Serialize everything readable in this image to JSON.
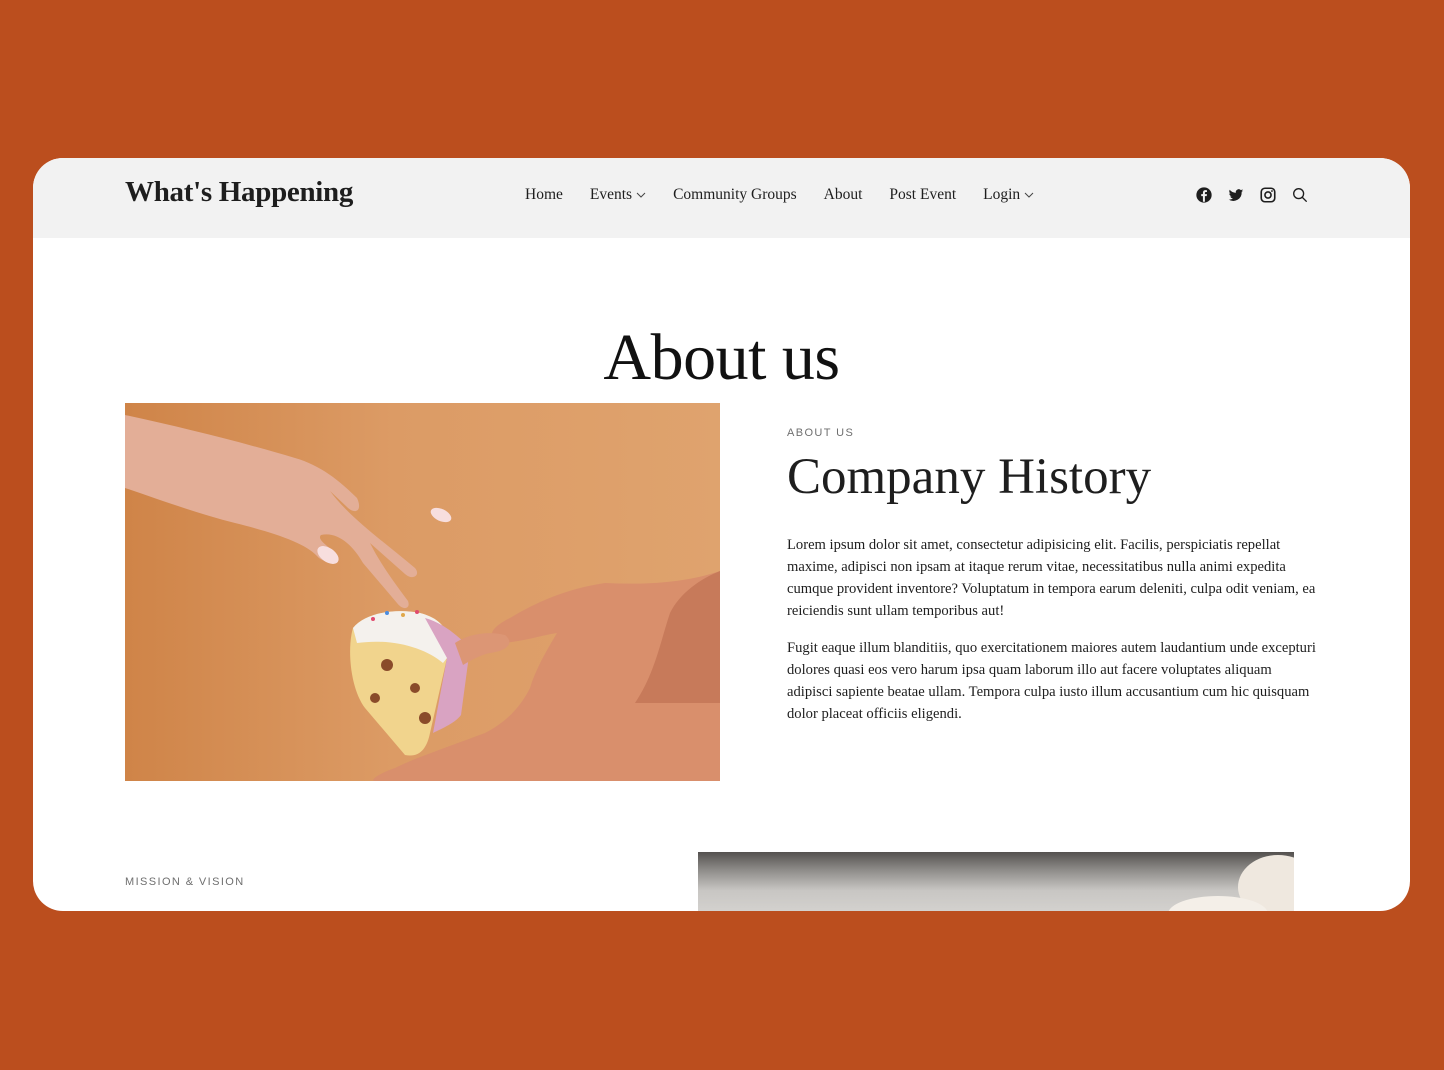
{
  "site": {
    "title": "What's Happening"
  },
  "nav": {
    "items": [
      {
        "label": "Home",
        "dropdown": false
      },
      {
        "label": "Events",
        "dropdown": true
      },
      {
        "label": "Community Groups",
        "dropdown": false
      },
      {
        "label": "About",
        "dropdown": false
      },
      {
        "label": "Post Event",
        "dropdown": false
      },
      {
        "label": "Login",
        "dropdown": true
      }
    ]
  },
  "social": {
    "icons": [
      "facebook-icon",
      "twitter-icon",
      "instagram-icon",
      "search-icon"
    ]
  },
  "page": {
    "title": "About us"
  },
  "history": {
    "eyebrow": "ABOUT US",
    "title": "Company History",
    "paragraph1": "Lorem ipsum dolor sit amet, consectetur adipisicing elit. Facilis, perspiciatis repellat maxime, adipisci non ipsam at itaque rerum vitae, necessitatibus nulla animi expedita cumque provident inventore? Voluptatum in tempora earum deleniti, culpa odit veniam, ea reiciendis sunt ullam temporibus aut!",
    "paragraph2": "Fugit eaque illum blanditiis, quo exercitationem maiores autem laudantium unde excepturi dolores quasi eos vero harum ipsa quam laborum illo aut facere voluptates aliquam adipisci sapiente beatae ullam. Tempora culpa iusto illum accusantium cum hic quisquam dolor placeat officiis eligendi."
  },
  "mission": {
    "eyebrow": "MISSION & VISION"
  },
  "colors": {
    "background": "#bb4e1e",
    "header": "#f2f2f2",
    "card": "#ffffff",
    "text": "#1e1e1e"
  }
}
